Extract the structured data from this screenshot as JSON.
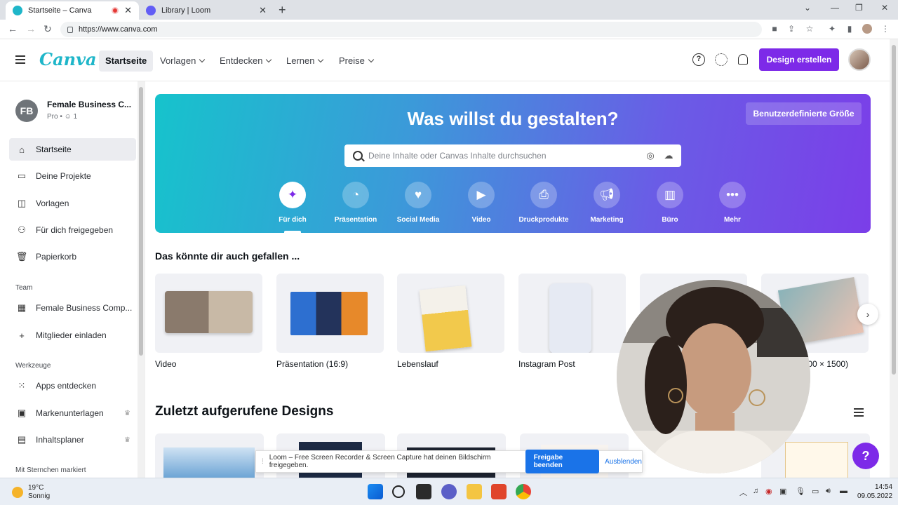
{
  "browser": {
    "tabs": [
      {
        "title": "Startseite – Canva",
        "active": true
      },
      {
        "title": "Library | Loom",
        "active": false
      }
    ],
    "url": "https://www.canva.com"
  },
  "header": {
    "logo": "Canva",
    "nav": [
      "Startseite",
      "Vorlagen",
      "Entdecken",
      "Lernen",
      "Preise"
    ],
    "create_button": "Design erstellen",
    "help_icon": "?"
  },
  "sidebar": {
    "team_initials": "FB",
    "team_name": "Female Business C...",
    "team_sub": "Pro • ☺ 1",
    "items": [
      "Startseite",
      "Deine Projekte",
      "Vorlagen",
      "Für dich freigegeben",
      "Papierkorb"
    ],
    "team_heading": "Team",
    "team_items": [
      "Female Business Comp...",
      "Mitglieder einladen"
    ],
    "tools_heading": "Werkzeuge",
    "tools_items": [
      "Apps entdecken",
      "Markenunterlagen",
      "Inhaltsplaner"
    ],
    "starred_heading": "Mit Sternchen markiert"
  },
  "hero": {
    "title": "Was willst du gestalten?",
    "custom_size": "Benutzerdefinierte Größe",
    "search_placeholder": "Deine Inhalte oder Canvas Inhalte durchsuchen",
    "categories": [
      "Für dich",
      "Präsentation",
      "Social Media",
      "Video",
      "Druckprodukte",
      "Marketing",
      "Büro",
      "Mehr"
    ]
  },
  "suggestions": {
    "title": "Das könnte dir auch gefallen ...",
    "cards": [
      "Video",
      "Präsentation (16:9)",
      "Lebenslauf",
      "Instagram Post",
      "",
      "n (1000 × 1500)"
    ]
  },
  "recent": {
    "title": "Zuletzt aufgerufene Designs"
  },
  "loom_bar": {
    "message": "Loom – Free Screen Recorder & Screen Capture hat deinen Bildschirm freigegeben.",
    "stop": "Freigabe beenden",
    "hide": "Ausblenden"
  },
  "taskbar": {
    "temp": "19°C",
    "weather": "Sonnig",
    "time": "14:54",
    "date": "09.05.2022"
  },
  "colors": {
    "brand_purple": "#7d2ae8",
    "logo_teal": "#1fb6c9"
  }
}
